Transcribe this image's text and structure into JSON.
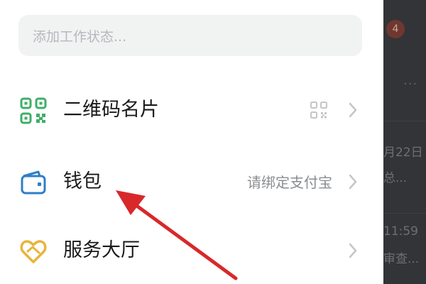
{
  "status": {
    "placeholder": "添加工作状态..."
  },
  "menu": {
    "items": [
      {
        "label": "二维码名片",
        "icon": "qr-code-icon",
        "hint": ""
      },
      {
        "label": "钱包",
        "icon": "wallet-icon",
        "hint": "请绑定支付宝"
      },
      {
        "label": "服务大厅",
        "icon": "heart-hands-icon",
        "hint": ""
      }
    ]
  },
  "background": {
    "badge": "4",
    "more": "···",
    "date_fragment": "月22日",
    "text_fragment_1": "总...",
    "time_fragment": "11:59",
    "text_fragment_2": "审查..."
  },
  "colors": {
    "qr_icon": "#3fae67",
    "wallet_icon": "#2e7fc6",
    "service_icon": "#e8b53a",
    "arrow": "#d8282a"
  }
}
